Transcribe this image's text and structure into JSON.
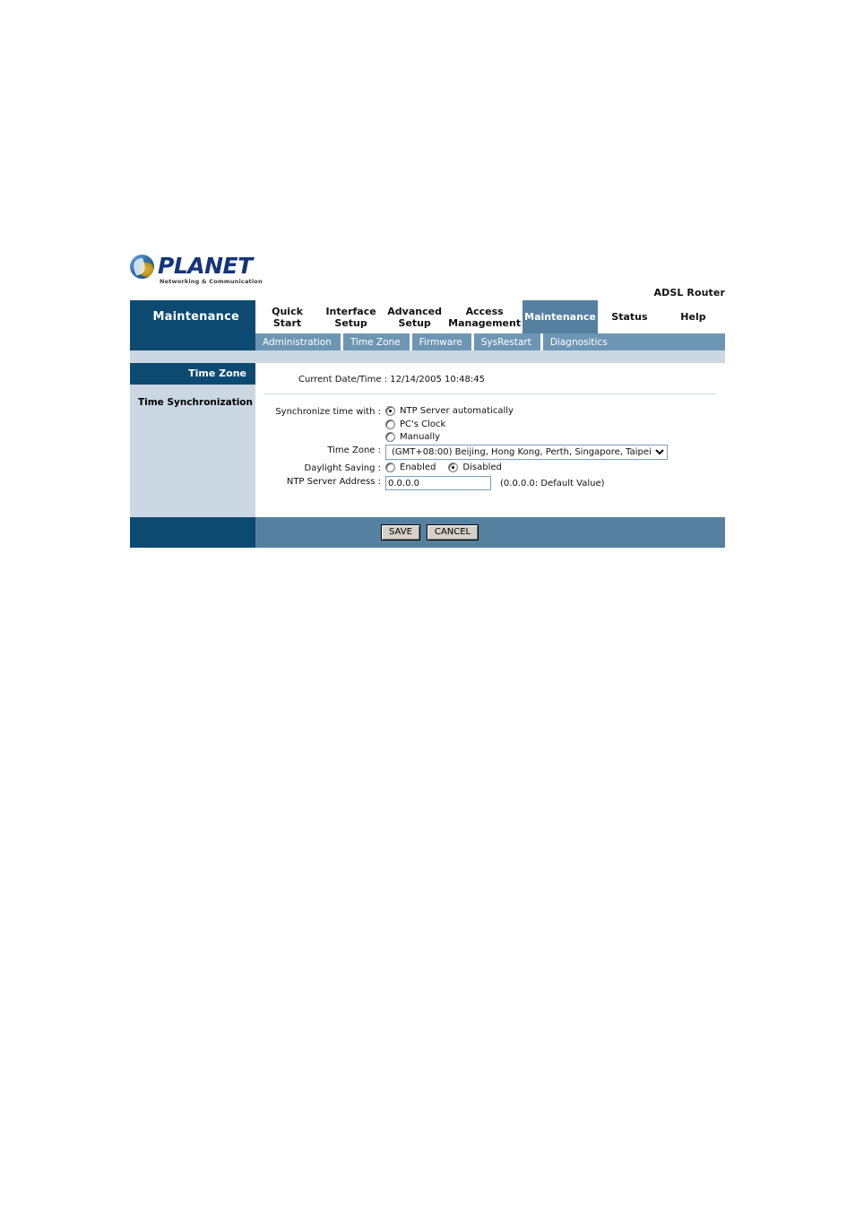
{
  "brand": {
    "logo_word": "PLANET",
    "logo_tagline": "Networking & Communication",
    "product_name": "ADSL Router"
  },
  "nav": {
    "section_title": "Maintenance",
    "main_tabs": [
      {
        "label": "Quick\nStart",
        "active": false
      },
      {
        "label": "Interface\nSetup",
        "active": false
      },
      {
        "label": "Advanced\nSetup",
        "active": false
      },
      {
        "label": "Access\nManagement",
        "active": false
      },
      {
        "label": "Maintenance",
        "active": true
      },
      {
        "label": "Status",
        "active": false
      },
      {
        "label": "Help",
        "active": false
      }
    ],
    "sub_tabs": [
      {
        "label": "Administration"
      },
      {
        "label": "Time Zone"
      },
      {
        "label": "Firmware"
      },
      {
        "label": "SysRestart"
      },
      {
        "label": "Diagnositics"
      }
    ]
  },
  "sidebar": {
    "header": "Time Zone",
    "items": [
      {
        "label": "Time Synchronization"
      }
    ]
  },
  "content": {
    "current_datetime_label": "Current Date/Time :",
    "current_datetime_value": "12/14/2005 10:48:45",
    "sync_label": "Synchronize time with :",
    "sync_options": [
      {
        "label": "NTP Server automatically",
        "selected": true
      },
      {
        "label": "PC's Clock",
        "selected": false
      },
      {
        "label": "Manually",
        "selected": false
      }
    ],
    "timezone_label": "Time Zone :",
    "timezone_value": "(GMT+08:00) Beijing, Hong Kong, Perth, Singapore, Taipei",
    "daylight_label": "Daylight Saving :",
    "daylight_options": [
      {
        "label": "Enabled",
        "selected": false
      },
      {
        "label": "Disabled",
        "selected": true
      }
    ],
    "ntp_label": "NTP Server Address :",
    "ntp_value": "0.0.0.0",
    "ntp_hint": "(0.0.0.0: Default Value)"
  },
  "footer": {
    "save_label": "SAVE",
    "cancel_label": "CANCEL"
  },
  "colors": {
    "navy": "#0d4a72",
    "steel": "#5580a0",
    "subtab": "#6d96b4",
    "light": "#cbd7e2",
    "brand_text": "#15347a"
  }
}
